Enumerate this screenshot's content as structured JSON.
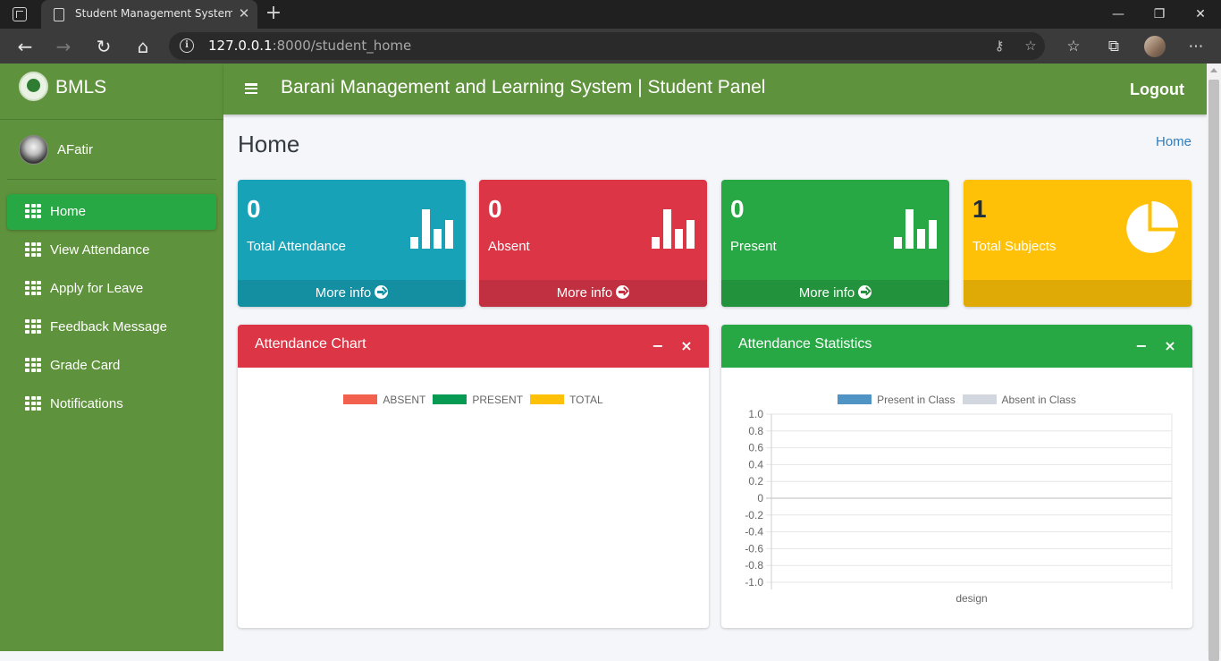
{
  "browser": {
    "tab_title": "Student Management System | Student",
    "url_host": "127.0.0.1",
    "url_path": ":8000/student_home"
  },
  "brand": {
    "name": "BMLS"
  },
  "user": {
    "name": "AFatir"
  },
  "sidebar": {
    "items": [
      {
        "label": "Home",
        "active": true
      },
      {
        "label": "View Attendance"
      },
      {
        "label": "Apply for Leave"
      },
      {
        "label": "Feedback Message"
      },
      {
        "label": "Grade Card"
      },
      {
        "label": "Notifications"
      }
    ]
  },
  "header": {
    "title": "Barani Management and Learning System | Student Panel",
    "logout": "Logout"
  },
  "page": {
    "title": "Home",
    "breadcrumb": "Home"
  },
  "stats": [
    {
      "value": "0",
      "label": "Total Attendance",
      "footer": "More info",
      "icon": "bar-chart-icon",
      "color": "#17a2b8"
    },
    {
      "value": "0",
      "label": "Absent",
      "footer": "More info",
      "icon": "bar-chart-icon",
      "color": "#dc3545"
    },
    {
      "value": "0",
      "label": "Present",
      "footer": "More info",
      "icon": "bar-chart-icon",
      "color": "#28a745"
    },
    {
      "value": "1",
      "label": "Total Subjects",
      "footer": "",
      "icon": "pie-chart-icon",
      "color": "#ffc107"
    }
  ],
  "cards": {
    "attendance_chart": {
      "title": "Attendance Chart",
      "minimize": "−",
      "close": "×"
    },
    "attendance_statistics": {
      "title": "Attendance Statistics",
      "minimize": "−",
      "close": "×"
    }
  },
  "chart_data": [
    {
      "type": "bar",
      "title": "Attendance Chart",
      "series": [
        {
          "name": "ABSENT",
          "color": "#f1614e",
          "values": []
        },
        {
          "name": "PRESENT",
          "color": "#079a52",
          "values": []
        },
        {
          "name": "TOTAL",
          "color": "#ffc107",
          "values": []
        }
      ],
      "categories": [],
      "legend": "top"
    },
    {
      "type": "bar",
      "title": "Attendance Statistics",
      "categories": [
        "design"
      ],
      "series": [
        {
          "name": "Present in Class",
          "color": "#4f94c5",
          "values": [
            0
          ]
        },
        {
          "name": "Absent in Class",
          "color": "#d2d6de",
          "values": [
            0
          ]
        }
      ],
      "yticks": [
        "1.0",
        "0.8",
        "0.6",
        "0.4",
        "0.2",
        "0",
        "-0.2",
        "-0.4",
        "-0.6",
        "-0.8",
        "-1.0"
      ],
      "ylim": [
        -1.0,
        1.0
      ],
      "grid": true,
      "legend": "top"
    }
  ]
}
